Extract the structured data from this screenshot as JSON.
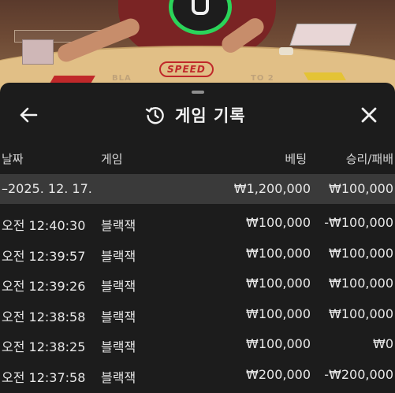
{
  "scene": {
    "logo_text": "SPEED",
    "felt_left": "BLA",
    "felt_right": "TO 2"
  },
  "header": {
    "title": "게임 기록",
    "back_icon": "arrow-left-icon",
    "history_icon": "history-icon",
    "close_icon": "close-icon"
  },
  "columns": {
    "date": "날짜",
    "game": "게임",
    "bet": "베팅",
    "result": "승리/패배"
  },
  "summary": {
    "date": "–2025. 12. 17.",
    "bet": "₩1,200,000",
    "result": "₩100,000"
  },
  "rows": [
    {
      "time": "오전 12:40:30",
      "game": "블랙잭",
      "bet": "₩100,000",
      "result": "-₩100,000"
    },
    {
      "time": "오전 12:39:57",
      "game": "블랙잭",
      "bet": "₩100,000",
      "result": "₩100,000"
    },
    {
      "time": "오전 12:39:26",
      "game": "블랙잭",
      "bet": "₩100,000",
      "result": "₩100,000"
    },
    {
      "time": "오전 12:38:58",
      "game": "블랙잭",
      "bet": "₩100,000",
      "result": "₩100,000"
    },
    {
      "time": "오전 12:38:25",
      "game": "블랙잭",
      "bet": "₩100,000",
      "result": "₩0"
    },
    {
      "time": "오전 12:37:58",
      "game": "블랙잭",
      "bet": "₩200,000",
      "result": "-₩200,000"
    }
  ],
  "colors": {
    "sheet_bg": "#1c1c1c",
    "summary_bg": "#3a3a3a",
    "wheel_accent": "#2bd45a",
    "logo_red": "#c0282a"
  }
}
